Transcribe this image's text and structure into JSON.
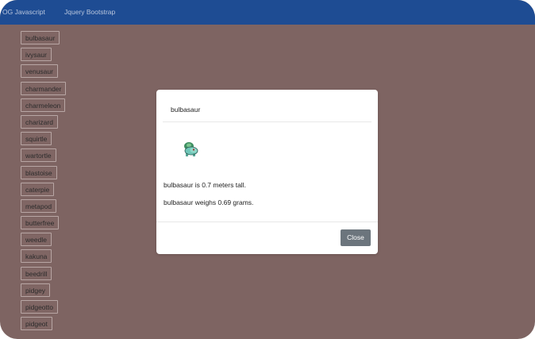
{
  "navbar": {
    "brand": "OG Javascript",
    "link": "Jquery Bootstrap"
  },
  "pokemon_list": [
    "bulbasaur",
    "ivysaur",
    "venusaur",
    "charmander",
    "charmeleon",
    "charizard",
    "squirtle",
    "wartortle",
    "blastoise",
    "caterpie",
    "metapod",
    "butterfree",
    "weedle",
    "kakuna",
    "beedrill",
    "pidgey",
    "pidgeotto",
    "pidgeot"
  ],
  "modal": {
    "title": "bulbasaur",
    "height_text": "bulbasaur is 0.7 meters tall.",
    "weight_text": "bulbasaur weighs 0.69 grams.",
    "close_label": "Close",
    "sprite_icon": "bulbasaur-sprite-icon"
  },
  "colors": {
    "navbar": "#1e4c93",
    "backdrop": "#7e6462",
    "close_button": "#6c757d"
  }
}
